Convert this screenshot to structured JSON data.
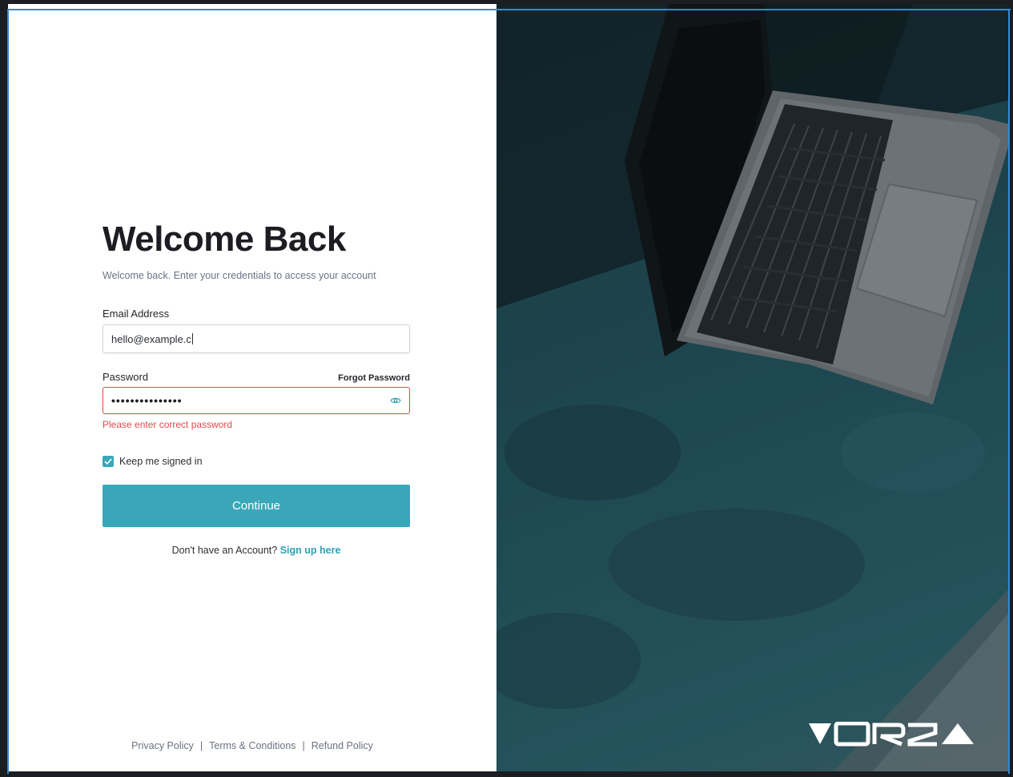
{
  "login": {
    "title": "Welcome Back",
    "subtitle": "Welcome back. Enter your credentials to access your account",
    "email_label": "Email Address",
    "email_value": "hello@example.c",
    "password_label": "Password",
    "forgot_label": "Forgot Password",
    "password_masked": "•••••••••••••••",
    "password_error": "Please enter correct password",
    "keep_signed_in_label": "Keep me signed in",
    "keep_signed_in_checked": true,
    "continue_label": "Continue",
    "no_account_text": "Don't have an Account?",
    "signup_label": "Sign up here"
  },
  "footer": {
    "privacy": "Privacy Policy",
    "terms": "Terms & Conditions",
    "refund": "Refund Policy",
    "separator": "|"
  },
  "brand": {
    "logo_text": "VORZA",
    "accent_color": "#3aa7b9",
    "error_color": "#e5484d"
  },
  "icons": {
    "password_toggle": "eye-icon",
    "checkbox": "checkmark-icon"
  }
}
